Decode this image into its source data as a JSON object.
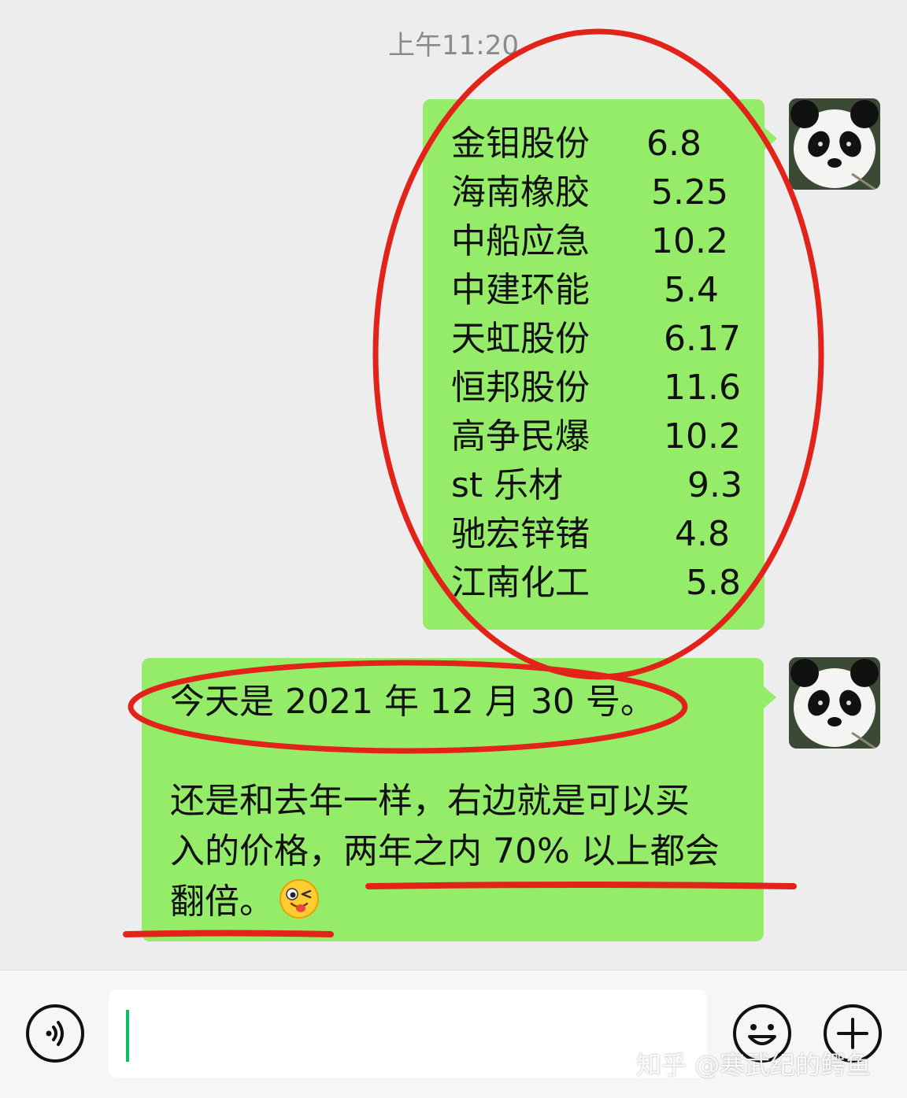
{
  "chat": {
    "timestamp": "上午11:20",
    "stock_message": {
      "rows": [
        {
          "name": "金钼股份",
          "price": "6.8"
        },
        {
          "name": "海南橡胶",
          "price": "5.25"
        },
        {
          "name": "中船应急",
          "price": "10.2"
        },
        {
          "name": "中建环能",
          "price": "5.4"
        },
        {
          "name": "天虹股份",
          "price": "6.17"
        },
        {
          "name": "恒邦股份",
          "price": "11.6"
        },
        {
          "name": "高争民爆",
          "price": "10.2"
        },
        {
          "name": "st 乐材",
          "price": "9.3"
        },
        {
          "name": "驰宏锌锗",
          "price": "4.8"
        },
        {
          "name": "江南化工",
          "price": "5.8"
        }
      ]
    },
    "text_message": {
      "line1": "今天是 2021 年 12 月 30 号。",
      "line2": "还是和去年一样，右边就是可以买",
      "line3": "入的价格，两年之内 70% 以上都会",
      "line4": "翻倍。",
      "emoji": "winking-tongue-emoji"
    }
  },
  "input_bar": {
    "placeholder": "",
    "voice_icon": "voice-icon",
    "emoji_icon": "smiley-icon",
    "more_icon": "plus-icon"
  },
  "watermark": "知乎 @寒武纪的鳄鱼",
  "colors": {
    "background": "#ededed",
    "bubble_green": "#95ec69",
    "annotation_red": "#e2231a",
    "caret_green": "#07c160"
  }
}
